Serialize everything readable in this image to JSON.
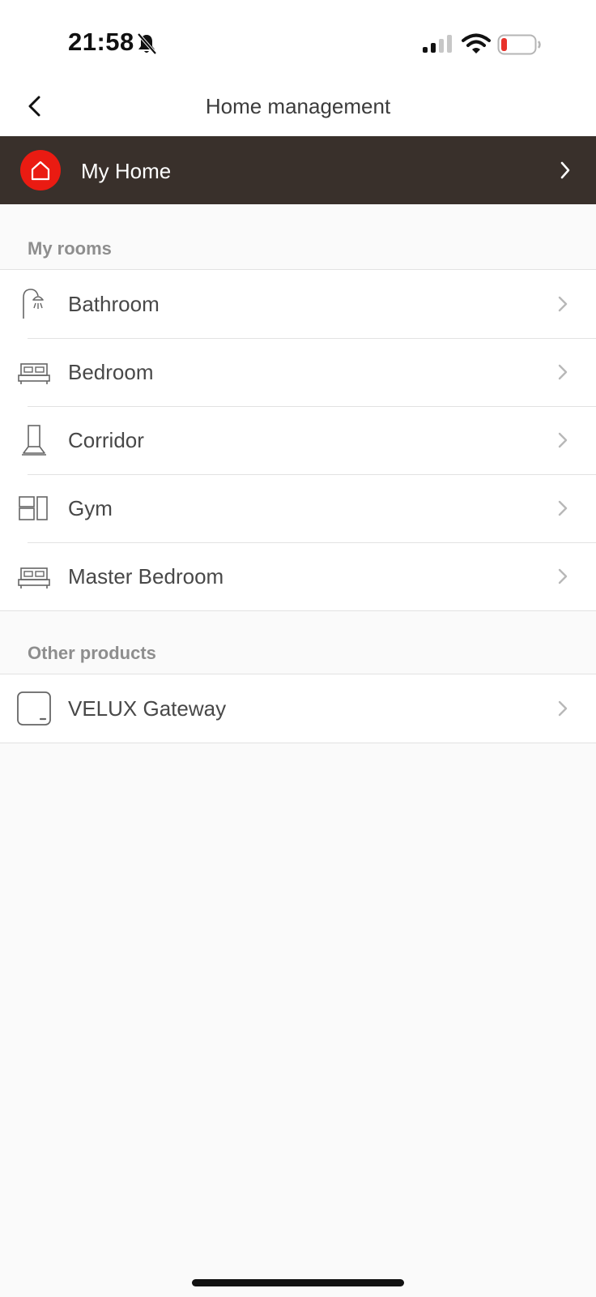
{
  "status_bar": {
    "time": "21:58",
    "icons": [
      "bell-muted-icon",
      "cellular-signal-icon",
      "wifi-icon",
      "battery-low-icon"
    ],
    "battery_color": "#e8312a"
  },
  "nav": {
    "title": "Home management",
    "back_icon": "chevron-left-icon"
  },
  "home": {
    "name": "My Home",
    "icon": "house-icon",
    "badge_color": "#ea1b12",
    "banner_color": "#39302b"
  },
  "rooms": {
    "header": "My rooms",
    "items": [
      {
        "label": "Bathroom",
        "icon": "shower-icon"
      },
      {
        "label": "Bedroom",
        "icon": "bed-icon"
      },
      {
        "label": "Corridor",
        "icon": "lamp-icon"
      },
      {
        "label": "Gym",
        "icon": "room-layout-icon"
      },
      {
        "label": "Master Bedroom",
        "icon": "bed-icon"
      }
    ]
  },
  "other_products": {
    "header": "Other products",
    "items": [
      {
        "label": "VELUX Gateway",
        "icon": "gateway-icon"
      }
    ]
  }
}
